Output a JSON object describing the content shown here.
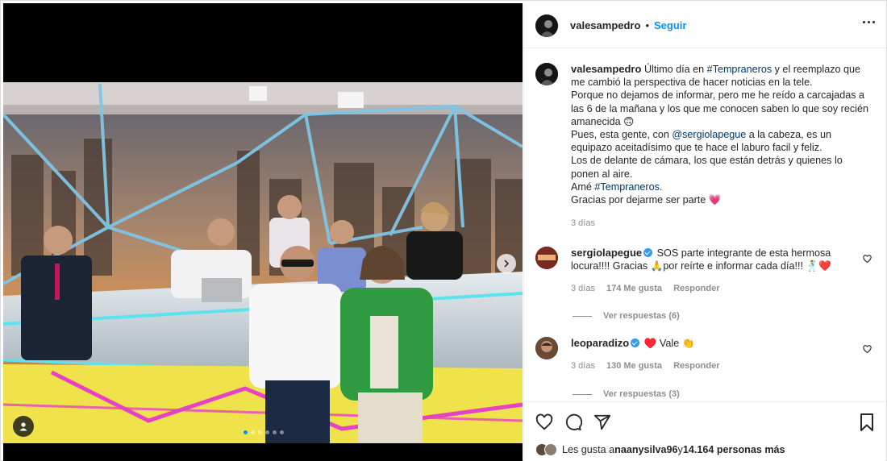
{
  "post": {
    "username": "valesampedro",
    "follow_label": "Seguir",
    "bullet": "•",
    "caption": {
      "username": "valesampedro",
      "line1_pre": "Último día en ",
      "line1_tag": "#Tempraneros",
      "line1_post": " y el reemplazo que me cambió la perspectiva de hacer noticias en la tele.",
      "line2": "Porque no dejamos de informar, pero me he reído a carcajadas a las 6 de la mañana y los que me conocen saben lo que soy recién amanecida 🙃",
      "line3_pre": "Pues, esta gente, con ",
      "line3_mention": "@sergiolapegue",
      "line3_post": " a la cabeza, es un equipazo aceitadísimo que te hace el laburo facil y feliz.",
      "line4": "Los de delante de cámara, los que están detrás y quienes lo ponen al aire.",
      "line5_pre": "Amé ",
      "line5_tag": "#Tempraneros",
      "line5_post": ".",
      "line6": "Gracias por dejarme ser parte 💗",
      "time": "3 días"
    },
    "comments": [
      {
        "username": "sergiolapegue",
        "text": "SOS parte integrante de esta hermosa locura!!!! Gracias 🙏por reírte e informar cada día!!! 🕺❤️",
        "time": "3 días",
        "likes": "174 Me gusta",
        "reply": "Responder",
        "view_replies": "Ver respuestas (6)"
      },
      {
        "username": "leoparadizo",
        "text": "♥️ Vale 👏",
        "time": "3 días",
        "likes": "130 Me gusta",
        "reply": "Responder",
        "view_replies": "Ver respuestas (3)"
      }
    ],
    "likes_line": {
      "prefix": "Les gusta a ",
      "user": "naanysilva96",
      "middle": " y ",
      "count": "14.164 personas más"
    }
  },
  "icons": {
    "more": "more-options-icon",
    "heart": "heart-icon",
    "comment": "comment-icon",
    "share": "share-icon",
    "save": "bookmark-icon",
    "next": "chevron-right-icon",
    "tag": "user-tag-icon"
  },
  "carousel": {
    "total": 6,
    "active": 1
  },
  "colors": {
    "accent": "#0095f6",
    "link": "#00376b",
    "muted": "#8e8e8e",
    "text": "#262626"
  }
}
